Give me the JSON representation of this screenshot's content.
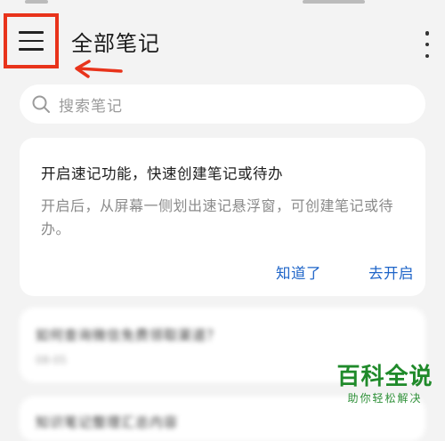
{
  "header": {
    "title": "全部笔记",
    "menu_icon": "hamburger-menu-icon",
    "more_icon": "more-vert-icon",
    "highlight_color": "#e8331b"
  },
  "search": {
    "placeholder": "搜索笔记",
    "icon": "search-icon"
  },
  "promo_card": {
    "heading": "开启速记功能，快速创建笔记或待办",
    "description": "开启后，从屏幕一侧划出速记悬浮窗，可创建笔记或待办。",
    "dismiss_label": "知道了",
    "enable_label": "去开启",
    "action_color": "#1e64c8"
  },
  "notes": [
    {
      "title": "如何查询微信免费领取渠道？",
      "date": "08-05"
    },
    {
      "title": "知识笔记整理汇总内容",
      "date": ""
    }
  ],
  "watermark": {
    "main": "百科全说",
    "sub": "助你轻松解决",
    "color": "#1f8a2a"
  }
}
